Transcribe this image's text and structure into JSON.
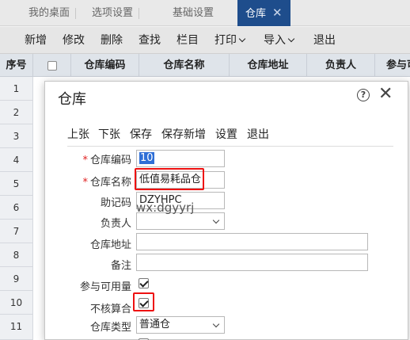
{
  "tabs": [
    {
      "label": "我的桌面"
    },
    {
      "label": "选项设置"
    },
    {
      "label": "基础设置"
    },
    {
      "label": "仓库",
      "active": true
    }
  ],
  "tab_close": "✕",
  "toolbar": {
    "add": "新增",
    "edit": "修改",
    "delete": "删除",
    "find": "查找",
    "columns": "栏目",
    "print": "打印",
    "import": "导入",
    "exit": "退出"
  },
  "grid": {
    "headers": [
      "序号",
      "仓库编码",
      "仓库名称",
      "仓库地址",
      "负责人",
      "参与可"
    ],
    "rows": [
      "1",
      "2",
      "3",
      "4",
      "5",
      "6",
      "7",
      "8",
      "9",
      "10",
      "11"
    ]
  },
  "modal": {
    "title": "仓库",
    "toolbar": {
      "prev": "上张",
      "next": "下张",
      "save": "保存",
      "save_new": "保存新增",
      "settings": "设置",
      "exit": "退出"
    },
    "fields": {
      "code_label": "仓库编码",
      "code_value": "10",
      "name_label": "仓库名称",
      "name_value": "低值易耗品仓",
      "mnemonic_label": "助记码",
      "mnemonic_value": "DZYHPC",
      "manager_label": "负责人",
      "manager_value": "",
      "address_label": "仓库地址",
      "address_value": "",
      "remark_label": "备注",
      "remark_value": "",
      "available_label": "参与可用量",
      "available_checked": true,
      "no_cost_label": "不核算合",
      "no_cost_checked": true,
      "type_label": "仓库类型",
      "type_value": "普通仓"
    },
    "required_mark": "*"
  },
  "watermark": "wx:dgyyrj",
  "colors": {
    "accent": "#1e4d8c",
    "highlight": "#e11111"
  }
}
